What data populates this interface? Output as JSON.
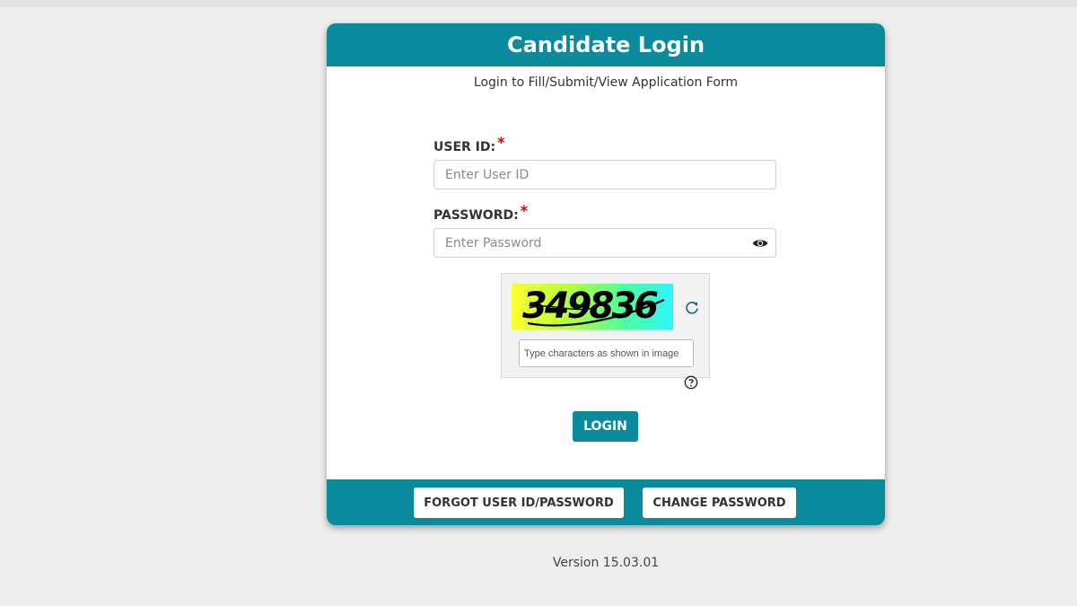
{
  "header": {
    "title": "Candidate Login",
    "subtitle": "Login to Fill/Submit/View Application Form"
  },
  "form": {
    "user_id": {
      "label": "USER ID:",
      "required_mark": "*",
      "value": "",
      "placeholder": "Enter User ID"
    },
    "password": {
      "label": "PASSWORD:",
      "required_mark": "*",
      "value": "",
      "placeholder": "Enter Password"
    },
    "captcha": {
      "code": "349836",
      "input_value": "",
      "placeholder": "Type characters as shown in image"
    },
    "login_label": "LOGIN"
  },
  "footer": {
    "forgot_label": "FORGOT USER ID/PASSWORD",
    "change_label": "CHANGE PASSWORD"
  },
  "version": "Version 15.03.01",
  "colors": {
    "primary": "#0a8a9c",
    "required": "#d00000",
    "page_background": "#eeeeee"
  },
  "icons": {
    "password_toggle": "eye-icon",
    "captcha_refresh": "refresh-icon",
    "captcha_help": "question-circle-icon"
  }
}
